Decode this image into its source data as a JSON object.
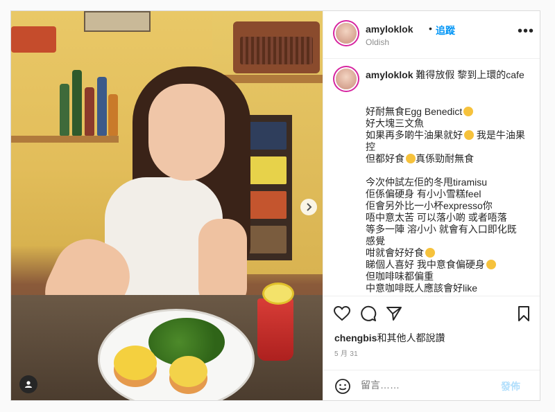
{
  "post": {
    "username": "amyloklok",
    "dot": "•",
    "follow_label": "追蹤",
    "location": "Oldish",
    "more_label": "•••"
  },
  "caption": {
    "username": "amyloklok",
    "headline": "難得放假 黎到上環的cafe",
    "lines": [
      "好耐無食Egg Benedict",
      "好大塊三文魚",
      "如果再多啲牛油果就好",
      "我是牛油果控",
      "但都好食",
      "真係勁耐無食",
      "",
      "今次仲試左佢的冬甩tiramisu",
      "佢係偏硬身 有小小雪糕feel",
      "佢會另外比一小杯expresso你",
      "唔中意太苦 可以落小啲 或者唔落",
      "等多一陣 溶小小 就會有入口即化既",
      "感覺",
      "咁就會好好食",
      "睇個人喜好 我中意食偏硬身",
      "但咖啡味都偏重",
      "中意咖啡既人應該會好like"
    ]
  },
  "likes": {
    "user": "chengbis",
    "suffix": "和其他人都說讚"
  },
  "date": "5 月 31",
  "comment": {
    "placeholder": "留言……",
    "post_label": "發佈"
  },
  "colors": {
    "accent": "#0095f6",
    "muted": "#8e8e8e",
    "post_disabled": "#b2dffc"
  },
  "icons": [
    "heart-icon",
    "comment-icon",
    "share-icon",
    "bookmark-icon",
    "smile-icon",
    "chevron-right-icon",
    "user-tag-icon"
  ]
}
